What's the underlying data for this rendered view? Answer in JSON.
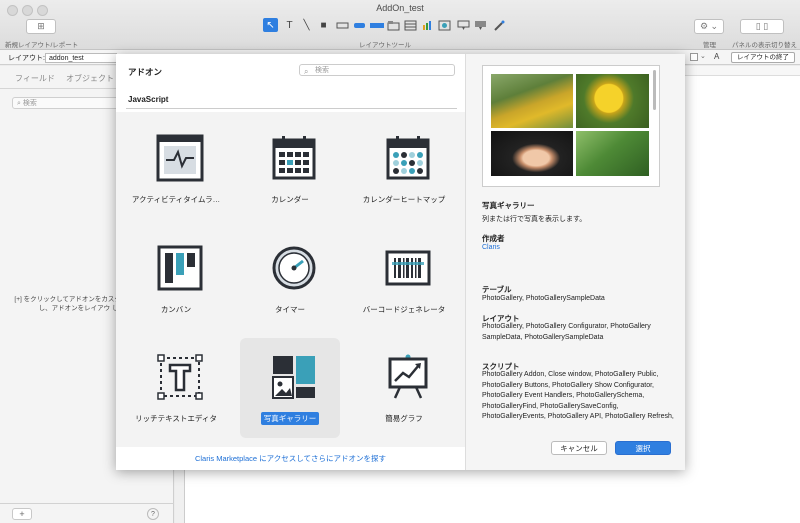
{
  "window": {
    "title": "AddOn_test"
  },
  "toolbar": {
    "new_layout_label": "新規レイアウト/レポート",
    "layout_tools_label": "レイアウトツール",
    "manage_label": "管理",
    "panel_toggle_label": "パネルの表示切り替え"
  },
  "layoutbar": {
    "layout_label": "レイアウト:",
    "layout_value": "addon_test",
    "aa_label": "A",
    "exit_layout_label": "レイアウトの終了"
  },
  "left_panel": {
    "tabs": [
      "フィールド",
      "オブジェクト"
    ],
    "search_placeholder": "検索",
    "help_text": "[+] をクリックしてアドオンをカスタム ンストールし、アドオンをレイアウ します。"
  },
  "dialog": {
    "title": "アドオン",
    "search_placeholder": "検索",
    "section": "JavaScript",
    "addons": [
      {
        "label": "アクティビティタイムラ…",
        "icon": "activity-timeline-icon"
      },
      {
        "label": "カレンダー",
        "icon": "calendar-icon"
      },
      {
        "label": "カレンダーヒートマップ",
        "icon": "calendar-heatmap-icon"
      },
      {
        "label": "カンバン",
        "icon": "kanban-icon"
      },
      {
        "label": "タイマー",
        "icon": "timer-icon"
      },
      {
        "label": "バーコードジェネレータ",
        "icon": "barcode-icon"
      },
      {
        "label": "リッチテキストエディタ",
        "icon": "rich-text-icon"
      },
      {
        "label": "写真ギャラリー",
        "icon": "photo-gallery-icon",
        "selected": true
      },
      {
        "label": "簡易グラフ",
        "icon": "simple-chart-icon"
      }
    ],
    "marketplace_link": "Claris Marketplace にアクセスしてさらにアドオンを探す",
    "details": {
      "name": "写真ギャラリー",
      "description": "列または行で写真を表示します。",
      "author_label": "作成者",
      "author": "Claris",
      "tables_label": "テーブル",
      "tables": "PhotoGallery, PhotoGallerySampleData",
      "layouts_label": "レイアウト",
      "layouts": "PhotoGallery, PhotoGallery Configurator, PhotoGallery SampleData, PhotoGallerySampleData",
      "scripts_label": "スクリプト",
      "scripts": "PhotoGallery Addon, Close window, PhotoGallery Public, PhotoGallery Buttons, PhotoGallery Show Configurator, PhotoGallery Event Handlers, PhotoGallerySchema, PhotoGalleryFind, PhotoGallerySaveConfig, PhotoGalleryEvents, PhotoGallery API, PhotoGallery Refresh,"
    },
    "cancel_label": "キャンセル",
    "ok_label": "選択"
  },
  "colors": {
    "accent": "#2f7fe0",
    "icon_dark": "#2b2f36",
    "icon_teal": "#3aa0b8"
  }
}
